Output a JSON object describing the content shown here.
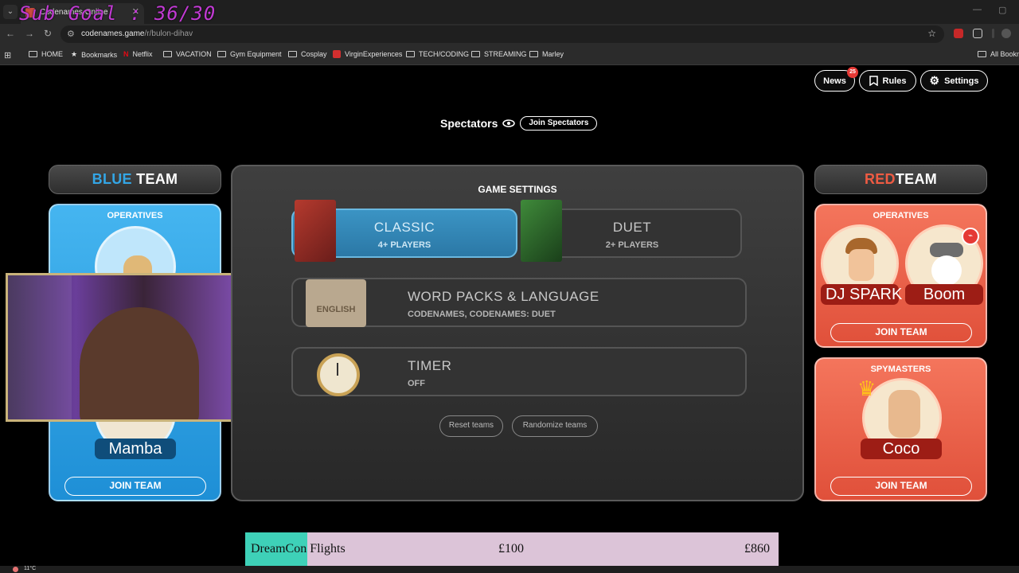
{
  "overlay": {
    "sub_goal": "Sub Goal : 36/30"
  },
  "browser": {
    "tab_title": "Codenames Online",
    "url_host": "codenames.game",
    "url_path": "/r/bulon-dihav",
    "bookmarks": [
      "HOME",
      "Bookmarks",
      "Netflix",
      "VACATION",
      "Gym Equipment",
      "Cosplay",
      "VirginExperiences",
      "TECH/CODING",
      "STREAMING",
      "Marley"
    ],
    "all_bookmarks": "All Bookm"
  },
  "header": {
    "news_label": "News",
    "news_count": "25",
    "rules_label": "Rules",
    "settings_label": "Settings"
  },
  "spectators": {
    "label": "Spectators",
    "join_label": "Join Spectators"
  },
  "blue_team": {
    "title_color_word": "BLUE",
    "title_word": "TEAM",
    "operatives_label": "OPERATIVES",
    "spymaster_name": "Mamba",
    "join_operatives": "JOIN TEAM",
    "join_spymasters": "JOIN TEAM"
  },
  "red_team": {
    "title_color_word": "RED",
    "title_word": "TEAM",
    "operatives_label": "OPERATIVES",
    "operatives": [
      "DJ SPARK",
      "Boom"
    ],
    "join_operatives": "JOIN TEAM",
    "spymasters_label": "SPYMASTERS",
    "spymaster_name": "Coco",
    "join_spymasters": "JOIN TEAM"
  },
  "game_settings": {
    "title": "GAME SETTINGS",
    "modes": [
      {
        "name": "CLASSIC",
        "players": "4+ PLAYERS",
        "selected": true
      },
      {
        "name": "DUET",
        "players": "2+ PLAYERS",
        "selected": false
      }
    ],
    "word_packs": {
      "title": "WORD PACKS & LANGUAGE",
      "value": "CODENAMES, CODENAMES: DUET",
      "box_label": "ENGLISH"
    },
    "timer": {
      "title": "TIMER",
      "value": "OFF"
    },
    "reset_label": "Reset teams",
    "randomize_label": "Randomize teams"
  },
  "donation": {
    "title": "DreamCon Flights",
    "current": "£100",
    "goal": "£860"
  },
  "taskbar": {
    "weather": "11°C"
  },
  "colors": {
    "blue": "#33a6e6",
    "red": "#ef5b43",
    "accent": "#3ed1b8"
  }
}
